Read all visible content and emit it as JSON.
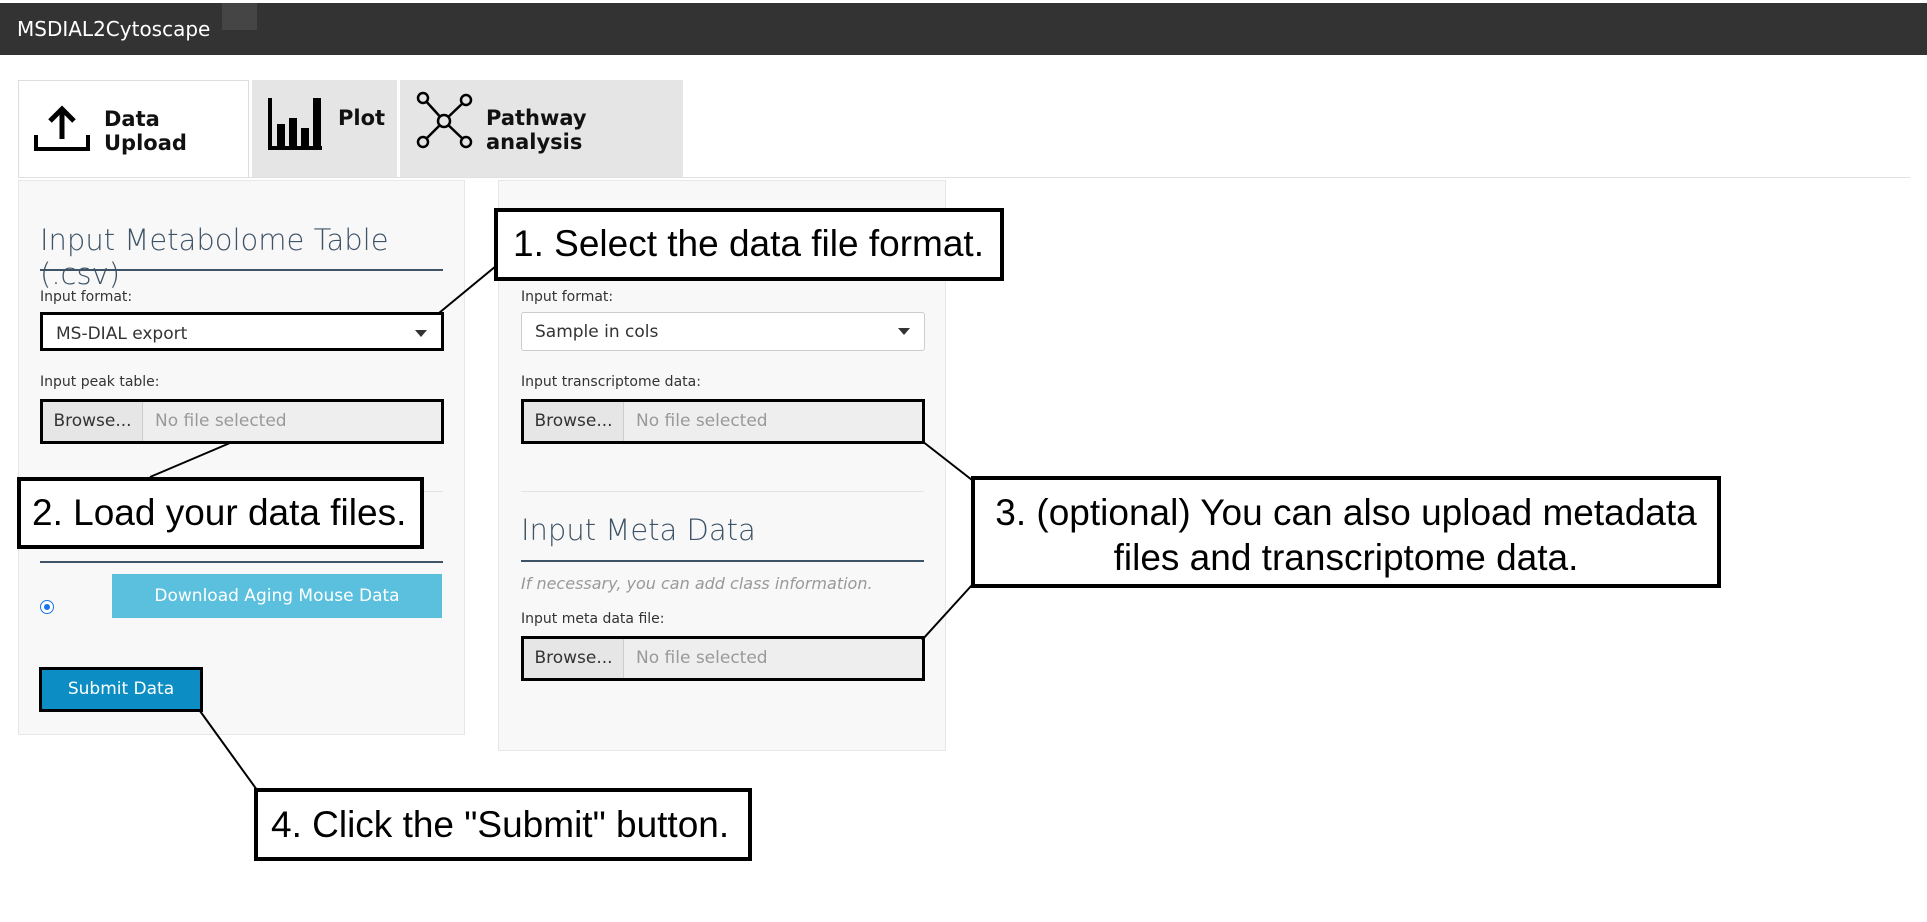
{
  "app": {
    "title": "MSDIAL2Cytoscape"
  },
  "tabs": [
    {
      "label": "Data Upload",
      "icon": "upload-icon",
      "active": true
    },
    {
      "label": "Plot",
      "icon": "bar-chart-icon",
      "active": false
    },
    {
      "label": "Pathway analysis",
      "icon": "network-icon",
      "active": false
    }
  ],
  "left_panel": {
    "title": "Input Metabolome Table (.csv)",
    "format_label": "Input format:",
    "format_value": "MS-DIAL export",
    "peak_label": "Input peak table:",
    "browse": "Browse...",
    "file_placeholder": "No file selected",
    "download_button": "Download Aging Mouse Data",
    "submit_button": "Submit Data"
  },
  "mid_panel": {
    "format_label": "Input format:",
    "format_value": "Sample in cols",
    "transcriptome_label": "Input transcriptome data:",
    "browse": "Browse...",
    "file_placeholder": "No file selected",
    "meta_title": "Input Meta Data",
    "meta_help": "If necessary, you can add class information.",
    "meta_label": "Input meta data file:"
  },
  "callouts": {
    "step1": "1. Select the data file format.",
    "step2": "2. Load your data files.",
    "step3_line1": "3. (optional) You can also upload metadata",
    "step3_line2": "files and transcriptome data.",
    "step4": "4. Click the \"Submit\" button."
  },
  "colors": {
    "topbar": "#333333",
    "download": "#5bc0de",
    "submit": "#0c8ec4",
    "heading": "#3e5366"
  }
}
